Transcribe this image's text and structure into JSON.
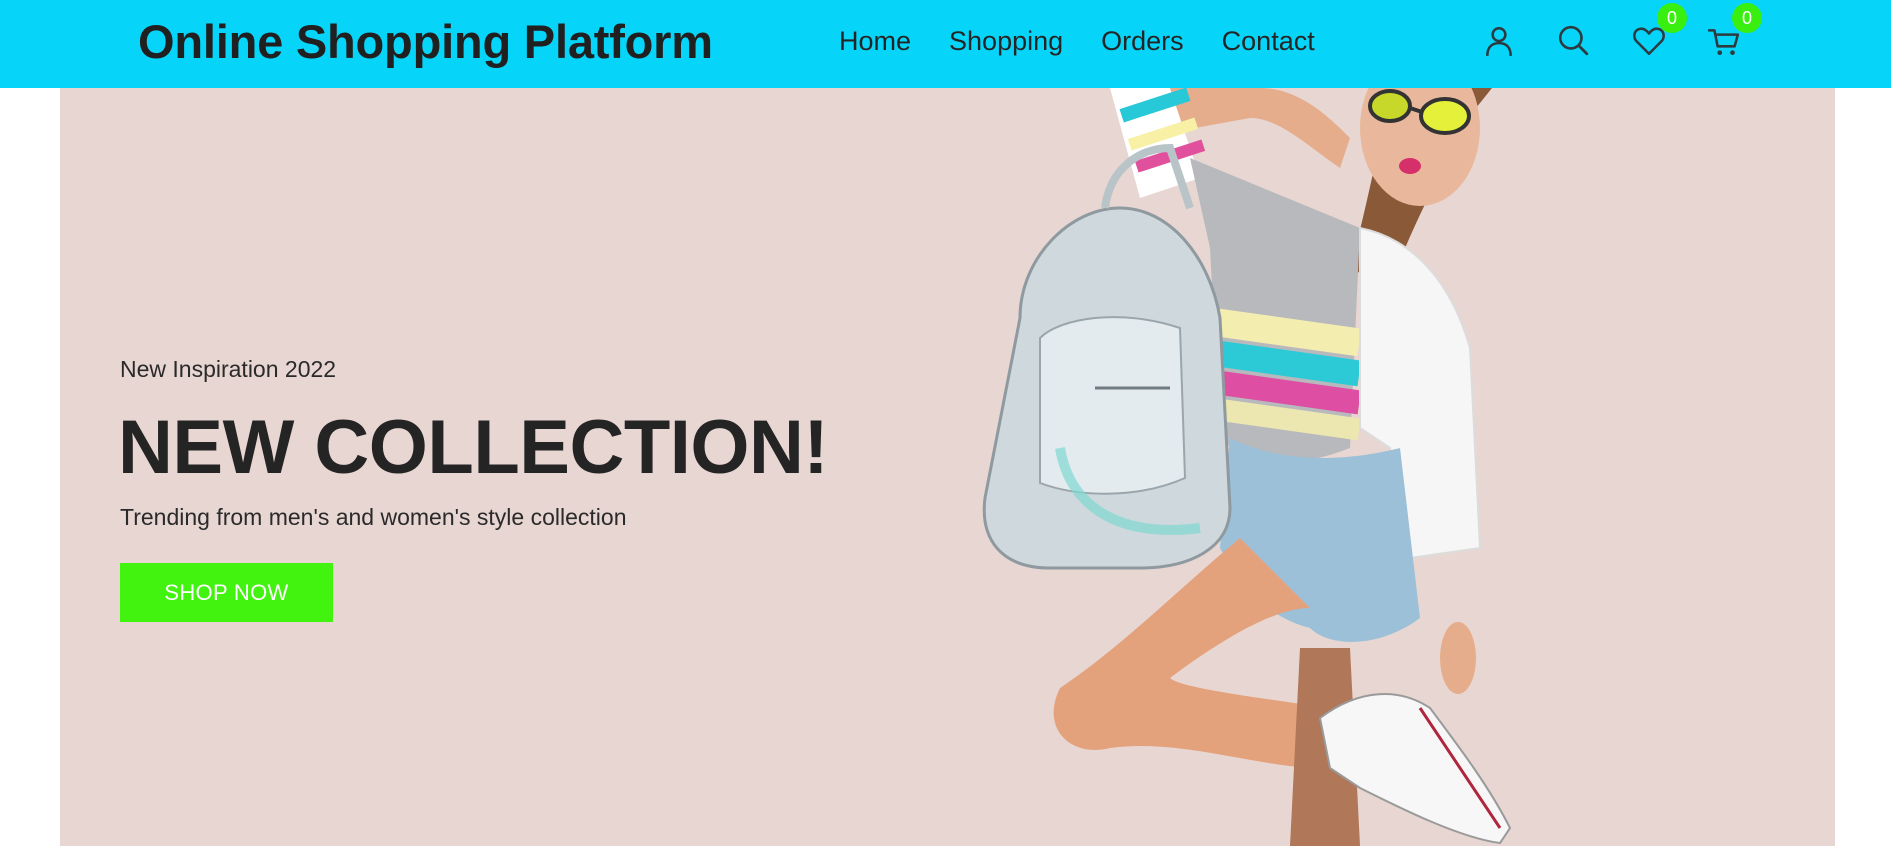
{
  "header": {
    "brand": "Online Shopping Platform",
    "nav": [
      {
        "label": "Home"
      },
      {
        "label": "Shopping"
      },
      {
        "label": "Orders"
      },
      {
        "label": "Contact"
      }
    ],
    "icons": {
      "account": "user-icon",
      "search": "search-icon",
      "wishlist": "heart-icon",
      "cart": "cart-icon"
    },
    "wishlist_count": "0",
    "cart_count": "0"
  },
  "hero": {
    "kicker": "New Inspiration 2022",
    "headline": "NEW COLLECTION!",
    "subtitle": "Trending from men's and women's style collection",
    "cta_label": "SHOP NOW",
    "image": "fashion-model-with-silver-backpack"
  },
  "colors": {
    "header_bg": "#06d4f8",
    "hero_bg": "#e8d6d2",
    "accent_green": "#42f30f",
    "badge_green": "#39ef0f",
    "text_dark": "#242424"
  }
}
